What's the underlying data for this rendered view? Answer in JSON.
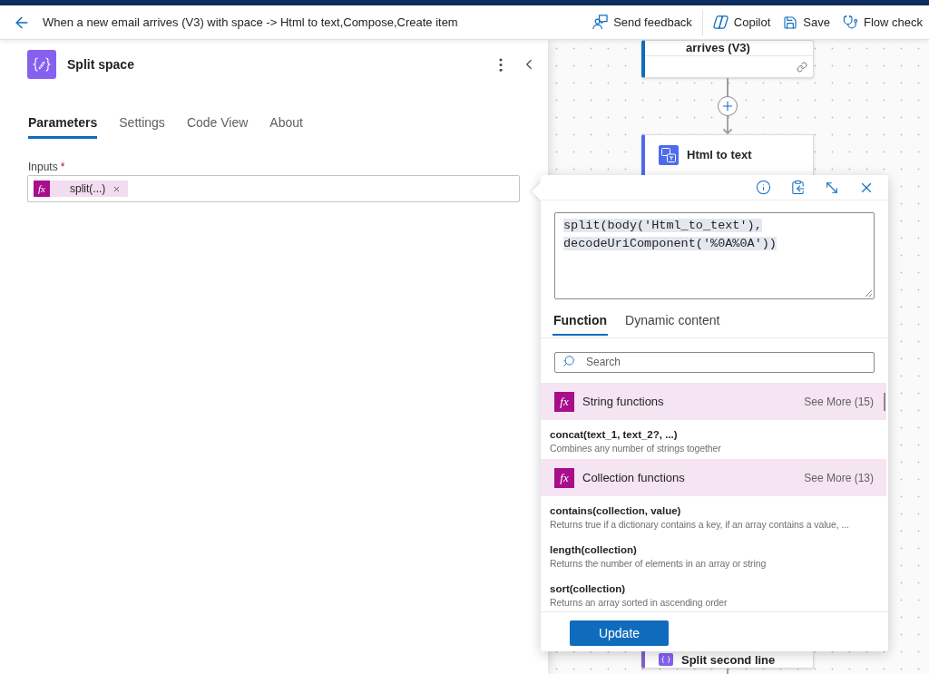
{
  "header": {
    "title": "When a new email arrives (V3) with space -> Html to text,Compose,Create item",
    "actions": [
      {
        "kind": "feedback",
        "label": "Send feedback"
      },
      {
        "kind": "copilot",
        "label": "Copilot"
      },
      {
        "kind": "save",
        "label": "Save"
      },
      {
        "kind": "checker",
        "label": "Flow check"
      }
    ]
  },
  "action_panel": {
    "title": "Split space",
    "tabs": [
      {
        "label": "Parameters",
        "selected": true
      },
      {
        "label": "Settings",
        "selected": false
      },
      {
        "label": "Code View",
        "selected": false
      },
      {
        "label": "About",
        "selected": false
      }
    ],
    "inputs": {
      "label": "Inputs",
      "required_mark": "*",
      "token": {
        "badge": "fx",
        "label": "split(...)"
      }
    }
  },
  "canvas": {
    "cards": [
      {
        "kind": "trigger",
        "title": "arrives (V3)"
      },
      {
        "kind": "html_to_text",
        "title": "Html to text"
      },
      {
        "kind": "compose",
        "title": "Split second line"
      }
    ]
  },
  "expression_editor": {
    "expression": "split(body('Html_to_text'), decodeUriComponent('%0A%0A'))",
    "tabs": [
      {
        "label": "Function",
        "selected": true
      },
      {
        "label": "Dynamic content",
        "selected": false
      }
    ],
    "search": {
      "placeholder": "Search"
    },
    "groups": [
      {
        "badge": "fx",
        "title": "String functions",
        "see_more": "See More (15)",
        "items": [
          {
            "signature": "concat(text_1, text_2?, ...)",
            "description": "Combines any number of strings together"
          }
        ]
      },
      {
        "badge": "fx",
        "title": "Collection functions",
        "see_more": "See More (13)",
        "items": [
          {
            "signature": "contains(collection, value)",
            "description": "Returns true if a dictionary contains a key, if an array contains a value, ..."
          },
          {
            "signature": "length(collection)",
            "description": "Returns the number of elements in an array or string"
          },
          {
            "signature": "sort(collection)",
            "description": "Returns an array sorted in ascending order"
          }
        ]
      }
    ],
    "button": "Update"
  }
}
